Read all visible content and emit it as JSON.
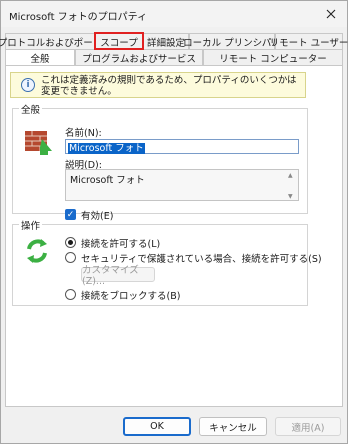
{
  "window": {
    "title": "Microsoft フォトのプロパティ"
  },
  "tabs_back": [
    {
      "label": "プロトコルおよびポート"
    },
    {
      "label": "スコープ"
    },
    {
      "label": "詳細設定"
    },
    {
      "label": "ローカル プリンシパル"
    },
    {
      "label": "リモート ユーザー"
    }
  ],
  "tabs_front": [
    {
      "label": "全般"
    },
    {
      "label": "プログラムおよびサービス"
    },
    {
      "label": "リモート コンピューター"
    }
  ],
  "notice": {
    "text": "これは定義済みの規則であるため、プロパティのいくつかは変更できません。"
  },
  "general": {
    "group_label": "全般",
    "name_label": "名前(N):",
    "name_value": "Microsoft フォト",
    "desc_label": "説明(D):",
    "desc_value": "Microsoft フォト",
    "enabled_label": "有効(E)",
    "enabled_checked": true
  },
  "action": {
    "group_label": "操作",
    "options": [
      {
        "label": "接続を許可する(L)",
        "checked": true
      },
      {
        "label": "セキュリティで保護されている場合、接続を許可する(S)",
        "checked": false
      },
      {
        "label": "接続をブロックする(B)",
        "checked": false
      }
    ],
    "customize_label": "カスタマイズ(Z)..."
  },
  "footer": {
    "ok_label": "OK",
    "cancel_label": "キャンセル",
    "apply_label": "適用(A)"
  }
}
